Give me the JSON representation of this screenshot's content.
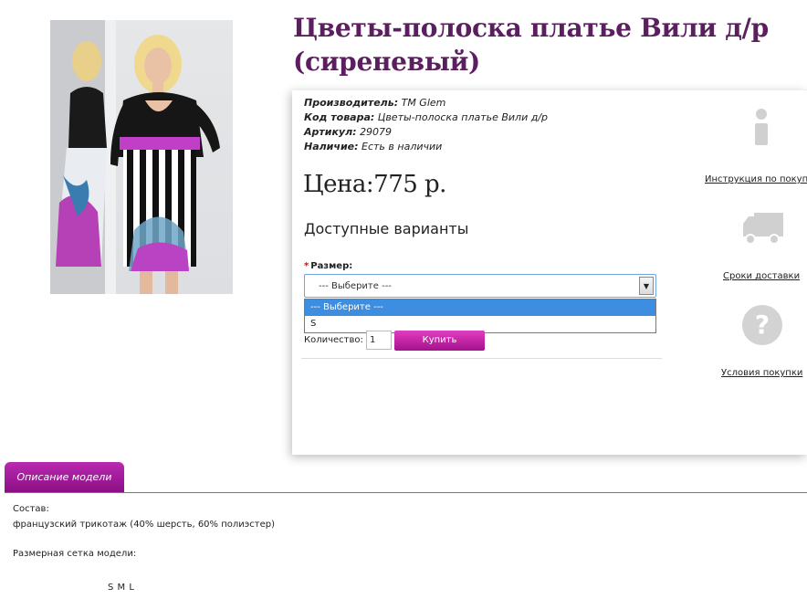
{
  "product": {
    "title": "Цветы-полоска платье Вили д/р (сиреневый)",
    "image_alt": "model-in-dress-photo"
  },
  "meta": {
    "manufacturer_label": "Производитель:",
    "manufacturer_value": "TM Glem",
    "code_label": "Код товара:",
    "code_value": "Цветы-полоска платье Вили д/р",
    "article_label": "Артикул:",
    "article_value": "29079",
    "stock_label": "Наличие:",
    "stock_value": "Есть в наличии"
  },
  "price": "Цена:775 р.",
  "options": {
    "heading": "Доступные варианты",
    "size_required_mark": "*",
    "size_label": "Размер:",
    "size_selected": "--- Выберите ---",
    "size_options": [
      "--- Выберите ---",
      "S"
    ]
  },
  "purchase": {
    "qty_label": "Количество:",
    "qty_value": "1",
    "buy_label": "Купить"
  },
  "sidebar": {
    "instruction_link": "Инструкция по покупке",
    "delivery_link": "Сроки доставки",
    "conditions_link": "Условия покупки"
  },
  "tabs": {
    "description_label": "Описание модели"
  },
  "description": {
    "composition_label": "Состав:",
    "composition_value": "французский трикотаж (40% шерсть, 60% полиэстер)",
    "size_chart_label": "Размерная сетка модели:",
    "size_chart_values": "S M L"
  },
  "colors": {
    "title": "#5b1e5f",
    "accent": "#a4118d",
    "link": "#222222",
    "select_highlight": "#3d8ee0"
  },
  "icons": [
    "info-icon",
    "truck-icon",
    "question-icon",
    "dropdown-arrow-icon"
  ]
}
